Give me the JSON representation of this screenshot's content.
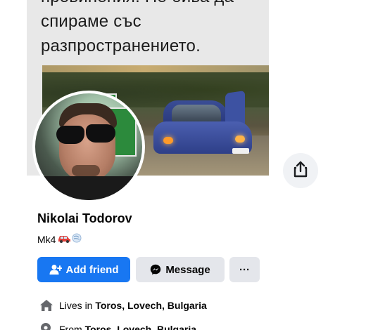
{
  "post": {
    "text_lines": [
      "провинения. Не бива да",
      "спираме със",
      "разпространението."
    ]
  },
  "profile": {
    "name": "Nikolai Todorov",
    "bio": "Mk4"
  },
  "actions": {
    "add_friend": "Add friend",
    "message": "Message",
    "more": "···"
  },
  "details": {
    "lives_in_prefix": "Lives in",
    "lives_in_place": "Toros, Lovech, Bulgaria",
    "from_prefix": "From",
    "from_place": "Toros, Lovech, Bulgaria"
  },
  "icons": {
    "share": "share-icon",
    "add_friend": "user-plus-icon",
    "message": "messenger-icon",
    "home": "home-icon",
    "location": "location-pin-icon",
    "car": "car-emoji-icon",
    "wind": "wind-emoji-icon"
  },
  "colors": {
    "primary": "#1877f2",
    "secondary_button": "#e4e6eb",
    "text": "#050505"
  }
}
